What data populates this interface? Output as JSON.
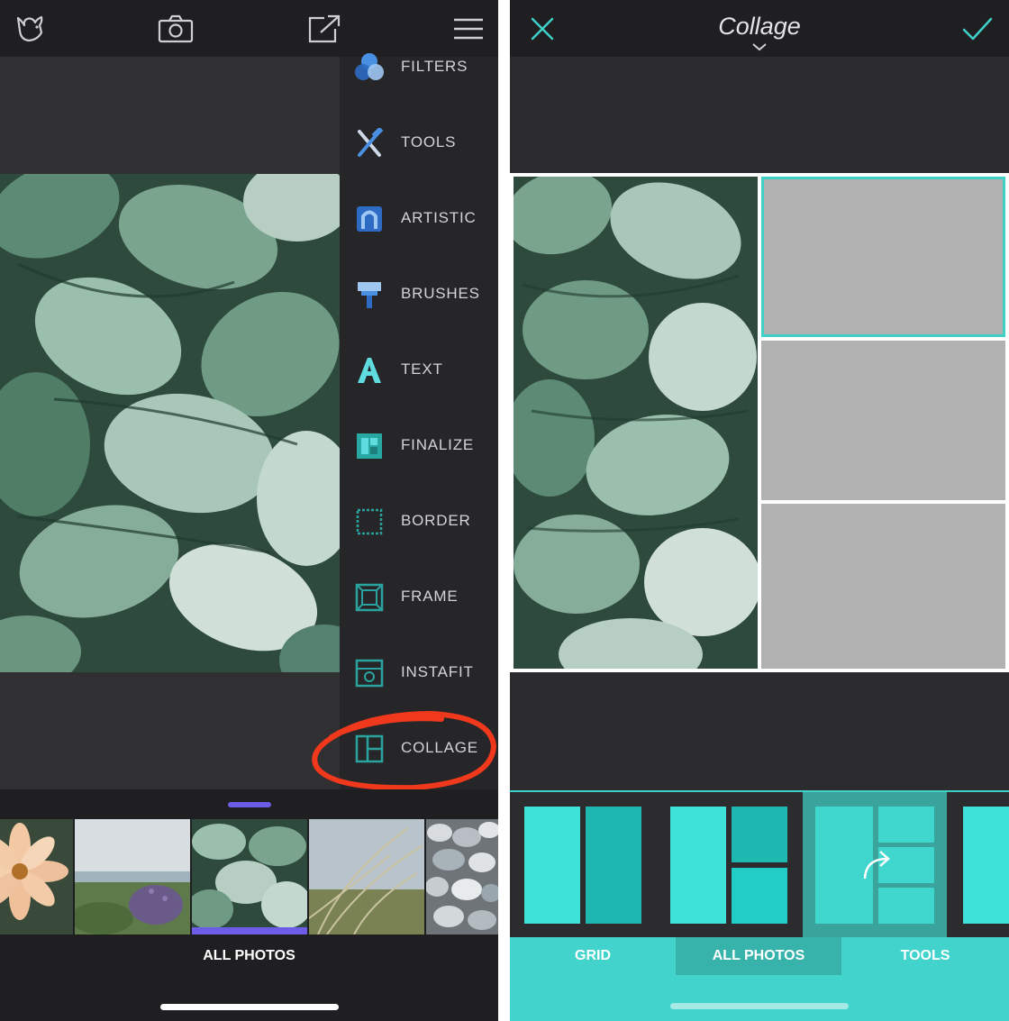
{
  "left_panel": {
    "topbar": {
      "icons": [
        "birdie-icon",
        "camera-icon",
        "share-icon",
        "menu-icon"
      ]
    },
    "menu": {
      "items": [
        {
          "label": "FILTERS",
          "icon": "filters-icon"
        },
        {
          "label": "TOOLS",
          "icon": "tools-icon"
        },
        {
          "label": "ARTISTIC",
          "icon": "artistic-icon"
        },
        {
          "label": "BRUSHES",
          "icon": "brushes-icon"
        },
        {
          "label": "TEXT",
          "icon": "text-icon"
        },
        {
          "label": "FINALIZE",
          "icon": "finalize-icon"
        },
        {
          "label": "BORDER",
          "icon": "border-icon"
        },
        {
          "label": "FRAME",
          "icon": "frame-icon"
        },
        {
          "label": "INSTAFIT",
          "icon": "instafit-icon"
        },
        {
          "label": "COLLAGE",
          "icon": "collage-icon"
        }
      ],
      "highlighted": "COLLAGE",
      "highlight_color": "#f0391c"
    },
    "strip": {
      "label": "ALL PHOTOS",
      "thumbnails": [
        "flower",
        "beach",
        "leaves",
        "grass",
        "pebbles"
      ],
      "selected_index": 2,
      "accent": "#6c5ce7"
    }
  },
  "right_panel": {
    "title": "Collage",
    "accent": "#3fd0c8",
    "collage": {
      "layout": "one-left-three-right",
      "selected_cell": 1
    },
    "layouts": {
      "options": [
        "two-columns",
        "one-left-two-right",
        "one-left-three-right",
        "partial"
      ],
      "active_index": 2
    },
    "tabs": [
      {
        "label": "GRID",
        "active": false
      },
      {
        "label": "ALL PHOTOS",
        "active": true
      },
      {
        "label": "TOOLS",
        "active": false
      }
    ]
  }
}
